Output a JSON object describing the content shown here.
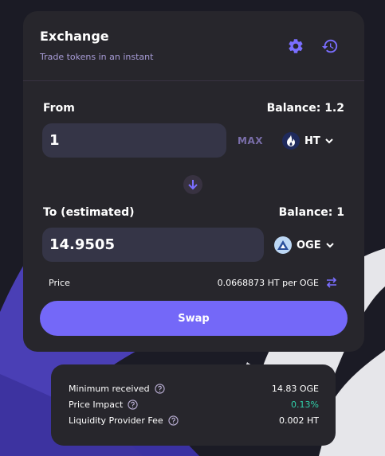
{
  "colors": {
    "background": "#1b1b25",
    "card": "#27262c",
    "input": "#353547",
    "accent": "#7468f8",
    "accent_text": "#7a6eaa",
    "subtitle": "#a99dd8",
    "success": "#31d0aa"
  },
  "header": {
    "title": "Exchange",
    "subtitle": "Trade tokens in an instant",
    "icons": [
      "gear-icon",
      "history-icon"
    ]
  },
  "from": {
    "label": "From",
    "balance": "Balance: 1.2",
    "amount": "1",
    "max_label": "MAX",
    "token": "HT",
    "token_icon": "huobi-flame-icon"
  },
  "to": {
    "label": "To (estimated)",
    "balance": "Balance: 1",
    "amount": "14.9505",
    "token": "OGE",
    "token_icon": "oge-icon"
  },
  "price": {
    "label": "Price",
    "value": "0.0668873 HT per OGE"
  },
  "swap_button": "Swap",
  "details": {
    "rows": [
      {
        "label": "Minimum received",
        "value": "14.83 OGE"
      },
      {
        "label": "Price Impact",
        "value": "0.13%"
      },
      {
        "label": "Liquidity Provider Fee",
        "value": "0.002 HT"
      }
    ]
  }
}
